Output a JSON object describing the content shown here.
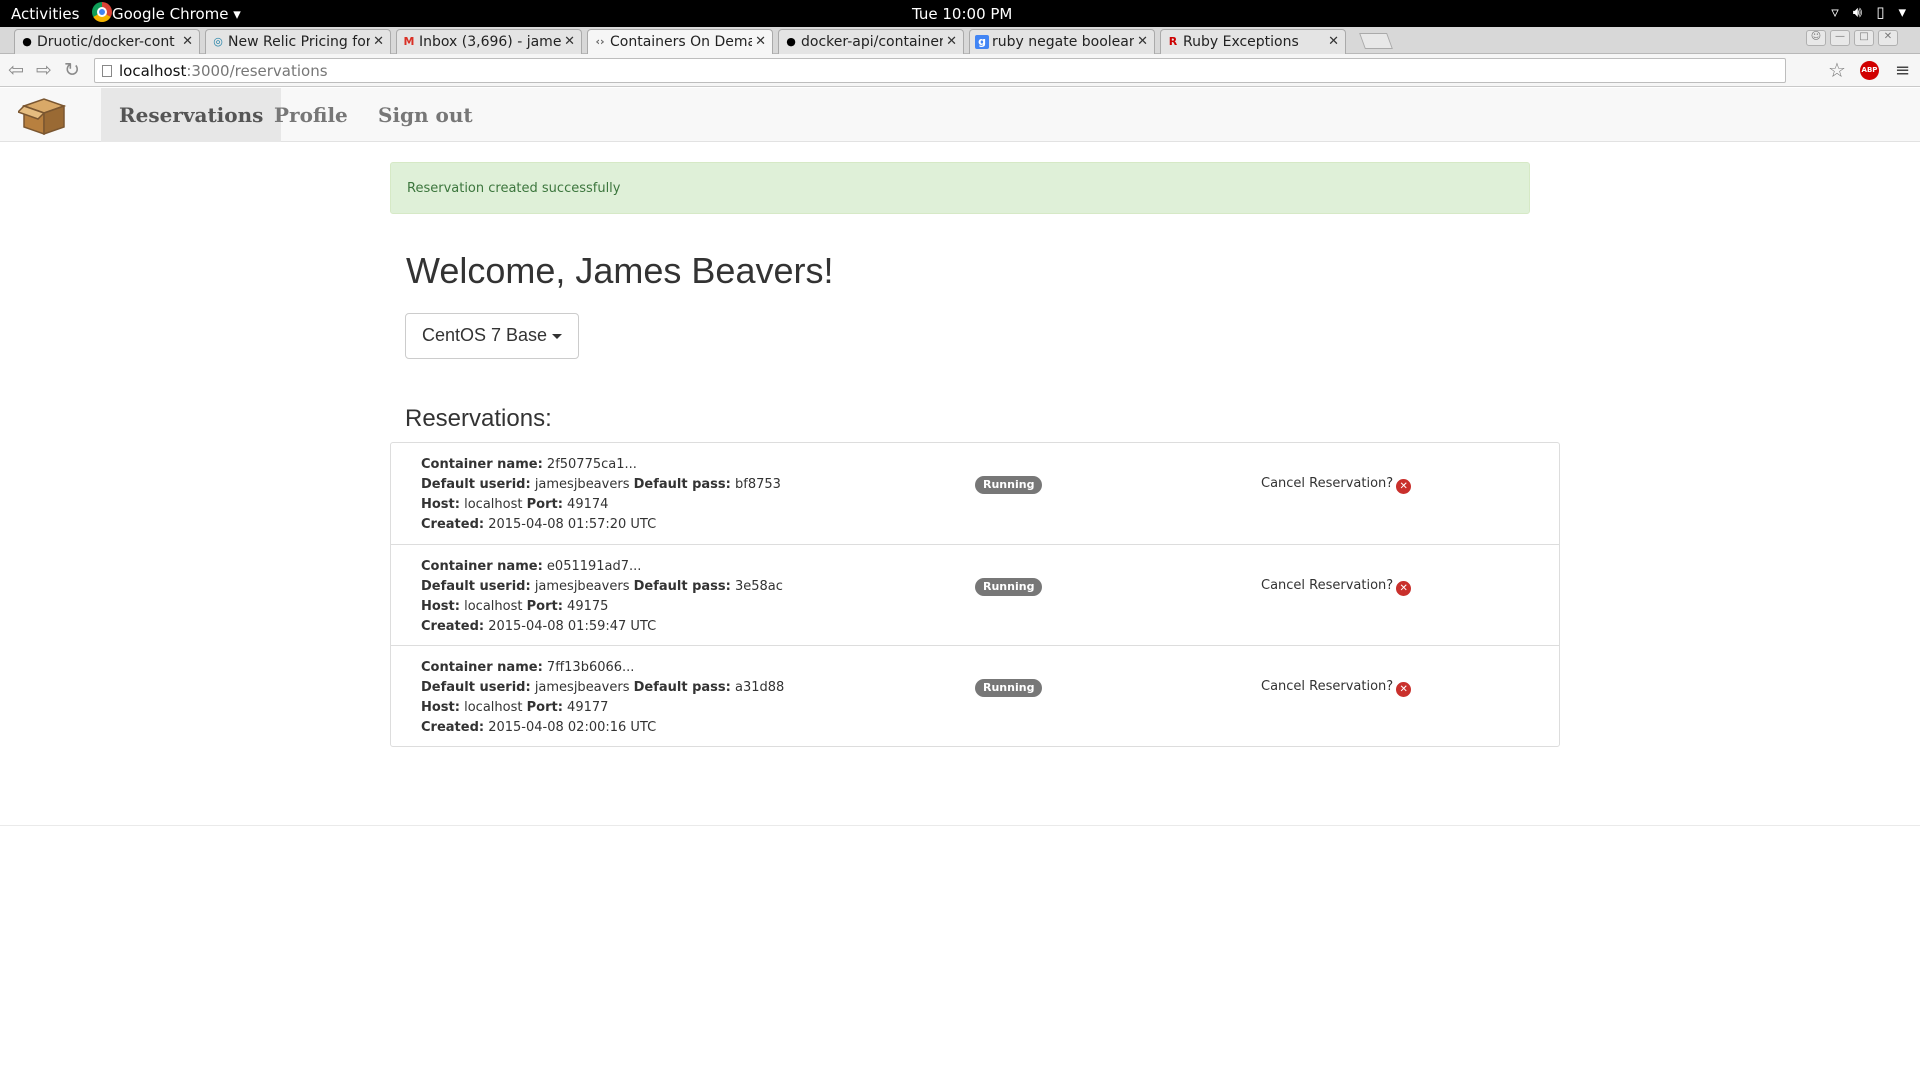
{
  "system": {
    "activities": "Activities",
    "app_menu": "Google Chrome ▾",
    "clock": "Tue 10:00 PM"
  },
  "tabs": [
    {
      "label": "Druotic/docker-cont",
      "fav": "github"
    },
    {
      "label": "New Relic Pricing for",
      "fav": "newrelic"
    },
    {
      "label": "Inbox (3,696) - jame",
      "fav": "gmail"
    },
    {
      "label": "Containers On Dema",
      "fav": "code"
    },
    {
      "label": "docker-api/container",
      "fav": "github"
    },
    {
      "label": "ruby negate boolean",
      "fav": "google"
    },
    {
      "label": "Ruby Exceptions",
      "fav": "ruby"
    }
  ],
  "address_bar": {
    "host": "localhost",
    "path": ":3000/reservations"
  },
  "nav": {
    "reservations": "Reservations",
    "profile": "Profile",
    "sign_out": "Sign out"
  },
  "alert": "Reservation created successfully",
  "welcome": "Welcome, James Beavers!",
  "image_dropdown": "CentOS 7 Base",
  "reservations_title": "Reservations:",
  "labels": {
    "container_name": "Container name:",
    "default_userid": "Default userid:",
    "default_pass": "Default pass:",
    "host": "Host:",
    "port": "Port:",
    "created": "Created:",
    "cancel": "Cancel Reservation?"
  },
  "reservations": [
    {
      "container": "2f50775ca1...",
      "userid": "jamesjbeavers",
      "pass": "bf8753",
      "host": "localhost",
      "port": "49174",
      "created": "2015-04-08 01:57:20 UTC",
      "status": "Running"
    },
    {
      "container": "e051191ad7...",
      "userid": "jamesjbeavers",
      "pass": "3e58ac",
      "host": "localhost",
      "port": "49175",
      "created": "2015-04-08 01:59:47 UTC",
      "status": "Running"
    },
    {
      "container": "7ff13b6066...",
      "userid": "jamesjbeavers",
      "pass": "a31d88",
      "host": "localhost",
      "port": "49177",
      "created": "2015-04-08 02:00:16 UTC",
      "status": "Running"
    }
  ]
}
